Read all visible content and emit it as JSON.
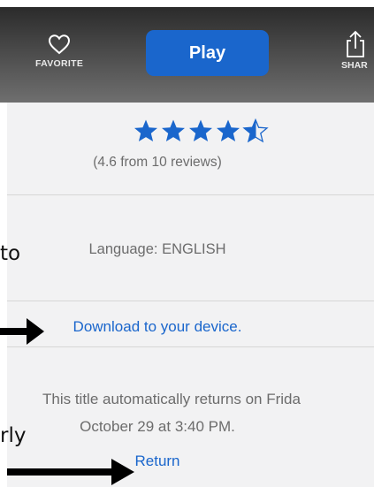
{
  "toolbar": {
    "favorite_label": "FAVORITE",
    "play_label": "Play",
    "share_label": "SHAR"
  },
  "rating": {
    "value": 4.6,
    "max": 5,
    "text": "(4.6 from 10 reviews)"
  },
  "details": {
    "language": "Language: ENGLISH",
    "download_link": "Download to your device.",
    "return_notice_line1": "This title automatically returns on Frida",
    "return_notice_line2": "October 29 at 3:40 PM.",
    "return_link": "Return"
  },
  "background_text": {
    "fragment_1": "to",
    "fragment_2": "rly"
  },
  "colors": {
    "accent": "#1a66cc",
    "star": "#1a66cc",
    "muted_text": "#6c6c6c",
    "panel_bg": "#f2f2f3"
  }
}
